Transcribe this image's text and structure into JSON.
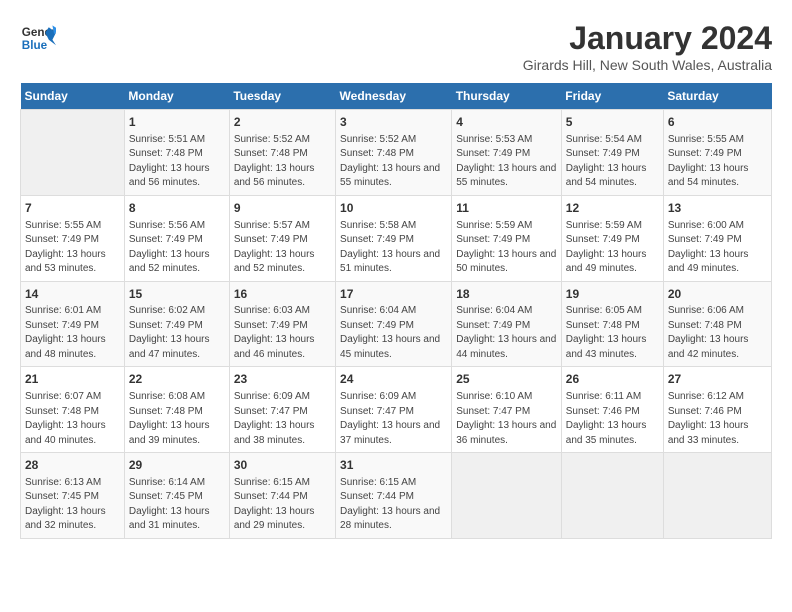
{
  "header": {
    "logo_general": "General",
    "logo_blue": "Blue",
    "month_title": "January 2024",
    "location": "Girards Hill, New South Wales, Australia"
  },
  "days_of_week": [
    "Sunday",
    "Monday",
    "Tuesday",
    "Wednesday",
    "Thursday",
    "Friday",
    "Saturday"
  ],
  "weeks": [
    [
      {
        "num": "",
        "sunrise": "",
        "sunset": "",
        "daylight": "",
        "empty": true
      },
      {
        "num": "1",
        "sunrise": "Sunrise: 5:51 AM",
        "sunset": "Sunset: 7:48 PM",
        "daylight": "Daylight: 13 hours and 56 minutes."
      },
      {
        "num": "2",
        "sunrise": "Sunrise: 5:52 AM",
        "sunset": "Sunset: 7:48 PM",
        "daylight": "Daylight: 13 hours and 56 minutes."
      },
      {
        "num": "3",
        "sunrise": "Sunrise: 5:52 AM",
        "sunset": "Sunset: 7:48 PM",
        "daylight": "Daylight: 13 hours and 55 minutes."
      },
      {
        "num": "4",
        "sunrise": "Sunrise: 5:53 AM",
        "sunset": "Sunset: 7:49 PM",
        "daylight": "Daylight: 13 hours and 55 minutes."
      },
      {
        "num": "5",
        "sunrise": "Sunrise: 5:54 AM",
        "sunset": "Sunset: 7:49 PM",
        "daylight": "Daylight: 13 hours and 54 minutes."
      },
      {
        "num": "6",
        "sunrise": "Sunrise: 5:55 AM",
        "sunset": "Sunset: 7:49 PM",
        "daylight": "Daylight: 13 hours and 54 minutes."
      }
    ],
    [
      {
        "num": "7",
        "sunrise": "Sunrise: 5:55 AM",
        "sunset": "Sunset: 7:49 PM",
        "daylight": "Daylight: 13 hours and 53 minutes."
      },
      {
        "num": "8",
        "sunrise": "Sunrise: 5:56 AM",
        "sunset": "Sunset: 7:49 PM",
        "daylight": "Daylight: 13 hours and 52 minutes."
      },
      {
        "num": "9",
        "sunrise": "Sunrise: 5:57 AM",
        "sunset": "Sunset: 7:49 PM",
        "daylight": "Daylight: 13 hours and 52 minutes."
      },
      {
        "num": "10",
        "sunrise": "Sunrise: 5:58 AM",
        "sunset": "Sunset: 7:49 PM",
        "daylight": "Daylight: 13 hours and 51 minutes."
      },
      {
        "num": "11",
        "sunrise": "Sunrise: 5:59 AM",
        "sunset": "Sunset: 7:49 PM",
        "daylight": "Daylight: 13 hours and 50 minutes."
      },
      {
        "num": "12",
        "sunrise": "Sunrise: 5:59 AM",
        "sunset": "Sunset: 7:49 PM",
        "daylight": "Daylight: 13 hours and 49 minutes."
      },
      {
        "num": "13",
        "sunrise": "Sunrise: 6:00 AM",
        "sunset": "Sunset: 7:49 PM",
        "daylight": "Daylight: 13 hours and 49 minutes."
      }
    ],
    [
      {
        "num": "14",
        "sunrise": "Sunrise: 6:01 AM",
        "sunset": "Sunset: 7:49 PM",
        "daylight": "Daylight: 13 hours and 48 minutes."
      },
      {
        "num": "15",
        "sunrise": "Sunrise: 6:02 AM",
        "sunset": "Sunset: 7:49 PM",
        "daylight": "Daylight: 13 hours and 47 minutes."
      },
      {
        "num": "16",
        "sunrise": "Sunrise: 6:03 AM",
        "sunset": "Sunset: 7:49 PM",
        "daylight": "Daylight: 13 hours and 46 minutes."
      },
      {
        "num": "17",
        "sunrise": "Sunrise: 6:04 AM",
        "sunset": "Sunset: 7:49 PM",
        "daylight": "Daylight: 13 hours and 45 minutes."
      },
      {
        "num": "18",
        "sunrise": "Sunrise: 6:04 AM",
        "sunset": "Sunset: 7:49 PM",
        "daylight": "Daylight: 13 hours and 44 minutes."
      },
      {
        "num": "19",
        "sunrise": "Sunrise: 6:05 AM",
        "sunset": "Sunset: 7:48 PM",
        "daylight": "Daylight: 13 hours and 43 minutes."
      },
      {
        "num": "20",
        "sunrise": "Sunrise: 6:06 AM",
        "sunset": "Sunset: 7:48 PM",
        "daylight": "Daylight: 13 hours and 42 minutes."
      }
    ],
    [
      {
        "num": "21",
        "sunrise": "Sunrise: 6:07 AM",
        "sunset": "Sunset: 7:48 PM",
        "daylight": "Daylight: 13 hours and 40 minutes."
      },
      {
        "num": "22",
        "sunrise": "Sunrise: 6:08 AM",
        "sunset": "Sunset: 7:48 PM",
        "daylight": "Daylight: 13 hours and 39 minutes."
      },
      {
        "num": "23",
        "sunrise": "Sunrise: 6:09 AM",
        "sunset": "Sunset: 7:47 PM",
        "daylight": "Daylight: 13 hours and 38 minutes."
      },
      {
        "num": "24",
        "sunrise": "Sunrise: 6:09 AM",
        "sunset": "Sunset: 7:47 PM",
        "daylight": "Daylight: 13 hours and 37 minutes."
      },
      {
        "num": "25",
        "sunrise": "Sunrise: 6:10 AM",
        "sunset": "Sunset: 7:47 PM",
        "daylight": "Daylight: 13 hours and 36 minutes."
      },
      {
        "num": "26",
        "sunrise": "Sunrise: 6:11 AM",
        "sunset": "Sunset: 7:46 PM",
        "daylight": "Daylight: 13 hours and 35 minutes."
      },
      {
        "num": "27",
        "sunrise": "Sunrise: 6:12 AM",
        "sunset": "Sunset: 7:46 PM",
        "daylight": "Daylight: 13 hours and 33 minutes."
      }
    ],
    [
      {
        "num": "28",
        "sunrise": "Sunrise: 6:13 AM",
        "sunset": "Sunset: 7:45 PM",
        "daylight": "Daylight: 13 hours and 32 minutes."
      },
      {
        "num": "29",
        "sunrise": "Sunrise: 6:14 AM",
        "sunset": "Sunset: 7:45 PM",
        "daylight": "Daylight: 13 hours and 31 minutes."
      },
      {
        "num": "30",
        "sunrise": "Sunrise: 6:15 AM",
        "sunset": "Sunset: 7:44 PM",
        "daylight": "Daylight: 13 hours and 29 minutes."
      },
      {
        "num": "31",
        "sunrise": "Sunrise: 6:15 AM",
        "sunset": "Sunset: 7:44 PM",
        "daylight": "Daylight: 13 hours and 28 minutes."
      },
      {
        "num": "",
        "sunrise": "",
        "sunset": "",
        "daylight": "",
        "empty": true
      },
      {
        "num": "",
        "sunrise": "",
        "sunset": "",
        "daylight": "",
        "empty": true
      },
      {
        "num": "",
        "sunrise": "",
        "sunset": "",
        "daylight": "",
        "empty": true
      }
    ]
  ]
}
